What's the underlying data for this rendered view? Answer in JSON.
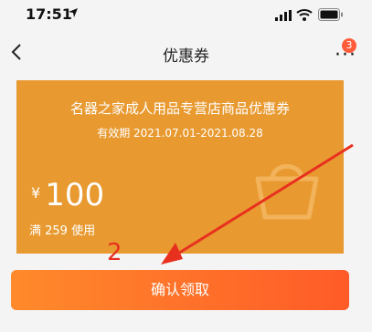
{
  "status_bar": {
    "time": "17:51"
  },
  "nav": {
    "title": "优惠券",
    "more_badge": "3"
  },
  "coupon": {
    "title": "名器之家成人用品专营店商品优惠券",
    "validity": "有效期 2021.07.01-2021.08.28",
    "currency": "¥",
    "amount": "100",
    "min_spend": "满 259 使用"
  },
  "confirm_button": {
    "label": "确认领取"
  },
  "annotation": {
    "number": "2"
  },
  "colors": {
    "coupon": "#e89a31",
    "button_start": "#ff8a2b",
    "button_end": "#ff5b28",
    "annotation": "#e8301e"
  },
  "icons": [
    "location-icon",
    "signal-icon",
    "wifi-icon",
    "battery-icon",
    "back-icon",
    "more-icon",
    "bag-icon",
    "arrow-icon"
  ]
}
